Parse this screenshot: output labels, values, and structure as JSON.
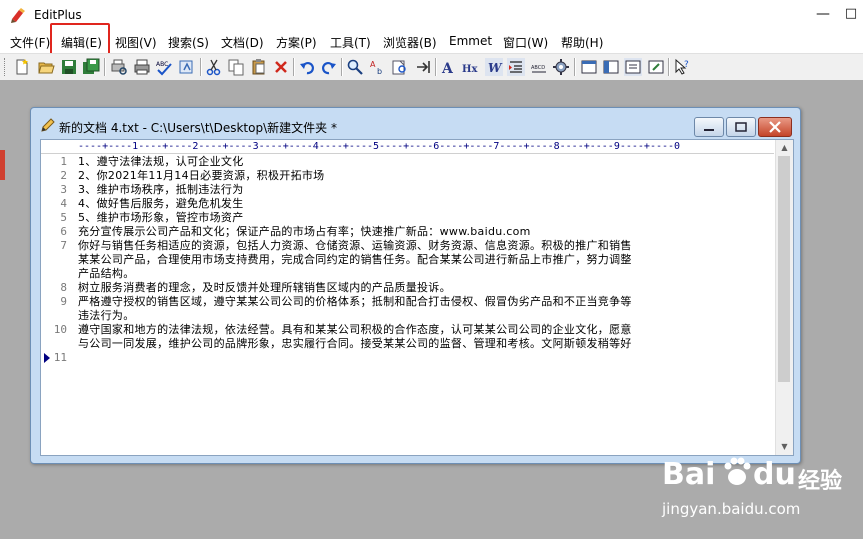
{
  "app": {
    "title": "EditPlus",
    "minimize_glyph": "—",
    "restore_glyph": "□"
  },
  "menu": [
    {
      "label": "文件(F)"
    },
    {
      "label": "编辑(E)"
    },
    {
      "label": "视图(V)"
    },
    {
      "label": "搜索(S)"
    },
    {
      "label": "文档(D)"
    },
    {
      "label": "方案(P)"
    },
    {
      "label": "工具(T)"
    },
    {
      "label": "浏览器(B)"
    },
    {
      "label": "Emmet"
    },
    {
      "label": "窗口(W)"
    },
    {
      "label": "帮助(H)"
    }
  ],
  "toolbar": {
    "icons": [
      "new-file-icon",
      "open-folder-icon",
      "save-icon",
      "save-all-icon",
      "print-preview-icon",
      "print-icon",
      "spell-check-icon",
      "ftp-upload-icon",
      "cut-icon",
      "copy-icon",
      "paste-icon",
      "delete-icon",
      "undo-icon",
      "redo-icon",
      "find-icon",
      "replace-icon",
      "find-in-files-icon",
      "goto-icon",
      "font-icon",
      "hex-icon",
      "word-wrap-icon",
      "indent-icon",
      "spell-icon",
      "settings-icon",
      "view-icon",
      "view-icon-2",
      "view-icon-3",
      "browser-icon",
      "help-pointer-icon"
    ],
    "spell_label": "ABC",
    "font_label": "A",
    "hex_label": "Hx",
    "wrap_label": "W",
    "abc_cd_label": "ABCD"
  },
  "document": {
    "title": "新的文档 4.txt - C:\\Users\\t\\Desktop\\新建文件夹 *",
    "ruler": "----+----1----+----2----+----3----+----4----+----5----+----6----+----7----+----8----+----9----+----0",
    "lines": [
      {
        "num": "1",
        "text": "1、遵守法律法规，认可企业文化"
      },
      {
        "num": "2",
        "text": "2、你2021年11月14日必要资源，积极开拓市场"
      },
      {
        "num": "3",
        "text": "3、维护市场秩序，抵制违法行为"
      },
      {
        "num": "4",
        "text": "4、做好售后服务，避免危机发生"
      },
      {
        "num": "5",
        "text": "5、维护市场形象，管控市场资产"
      },
      {
        "num": "6",
        "text": "充分宣传展示公司产品和文化；保证产品的市场占有率；快速推广新品：www.baidu.com"
      },
      {
        "num": "7",
        "text": "你好与销售任务相适应的资源，包括人力资源、仓储资源、运输资源、财务资源、信息资源。积极的推广和销售"
      },
      {
        "num": "",
        "text": "某某公司产品，合理使用市场支持费用，完成合同约定的销售任务。配合某某公司进行新品上市推广，努力调整"
      },
      {
        "num": "",
        "text": "产品结构。"
      },
      {
        "num": "8",
        "text": "树立服务消费者的理念，及时反馈并处理所辖销售区域内的产品质量投诉。"
      },
      {
        "num": "9",
        "text": "严格遵守授权的销售区域，遵守某某公司公司的价格体系；抵制和配合打击侵权、假冒伪劣产品和不正当竞争等"
      },
      {
        "num": "",
        "text": "违法行为。"
      },
      {
        "num": "10",
        "text": "遵守国家和地方的法律法规，依法经营。具有和某某公司积极的合作态度，认可某某公司公司的企业文化，愿意"
      },
      {
        "num": "",
        "text": "与公司一同发展，维护公司的品牌形象，忠实履行合同。接受某某公司的监督、管理和考核。文阿斯顿发稍等好"
      },
      {
        "num": "11",
        "text": ""
      }
    ]
  },
  "watermark": {
    "brand": "Bai",
    "brand2": "du",
    "cn": "经验",
    "url": "jingyan.baidu.com"
  },
  "colors": {
    "highlight": "#e0261e",
    "ruler": "#000080",
    "doc_frame": "#c6dcf3"
  }
}
